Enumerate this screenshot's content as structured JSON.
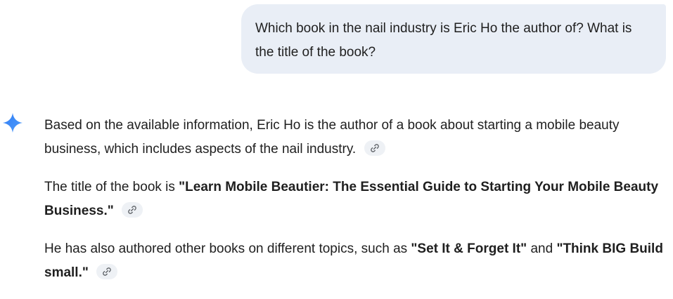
{
  "user_message": {
    "text": "Which book in the nail industry is Eric Ho the author of? What is the title of the book?"
  },
  "assistant": {
    "icon": "gemini-spark-icon",
    "paragraphs": {
      "p1": {
        "text": "Based on the available information, Eric Ho is the author of a book about starting a mobile beauty business, which includes aspects of the nail industry."
      },
      "p2": {
        "prefix": "The title of the book is ",
        "title": "\"Learn Mobile Beautier: The Essential Guide to Starting Your Mobile Beauty Business.\""
      },
      "p3": {
        "prefix": "He has also authored other books on different topics, such as ",
        "book1": "\"Set It & Forget It\"",
        "joiner": " and ",
        "book2": "\"Think BIG Build small.\""
      }
    },
    "citation_icon": "link-icon"
  },
  "colors": {
    "user_bubble_bg": "#e9eef6",
    "text": "#1f1f1f",
    "citation_chip_bg": "#eef1f5",
    "spark_blue": "#3b82f6"
  }
}
